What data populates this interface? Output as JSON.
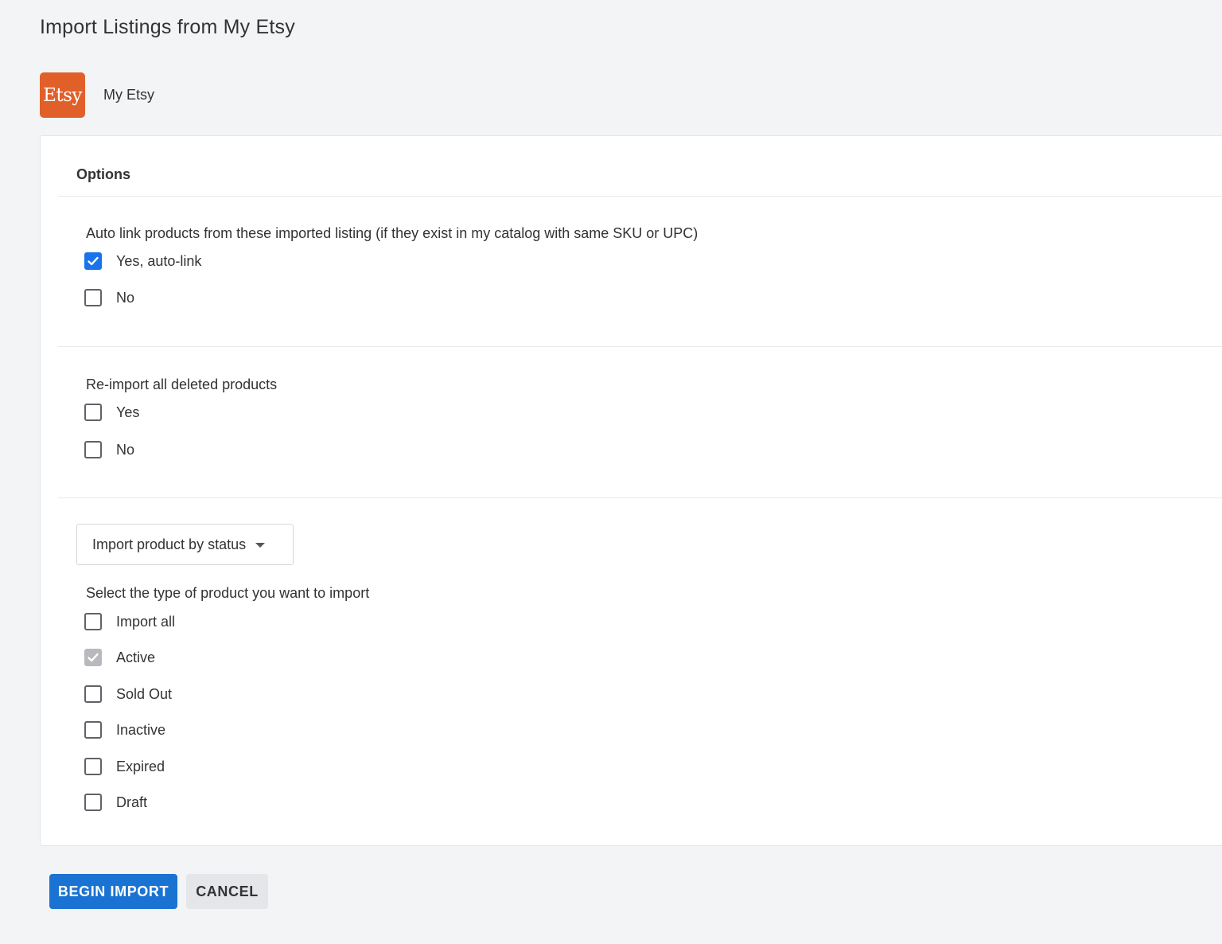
{
  "page": {
    "title": "Import Listings from My Etsy"
  },
  "store": {
    "logo_text": "Etsy",
    "name": "My Etsy",
    "brand_color": "#e1602a"
  },
  "options": {
    "header": "Options",
    "autolink": {
      "label": "Auto link products from these imported listing (if they exist in my catalog with same SKU or UPC)",
      "choices": [
        {
          "label": "Yes, auto-link",
          "checked": true
        },
        {
          "label": "No",
          "checked": false
        }
      ]
    },
    "reimport": {
      "label": "Re-import all deleted products",
      "choices": [
        {
          "label": "Yes",
          "checked": false
        },
        {
          "label": "No",
          "checked": false
        }
      ]
    },
    "status_select": {
      "selected": "Import product by status"
    },
    "product_types": {
      "label": "Select the type of product you want to import",
      "choices": [
        {
          "label": "Import all",
          "checked": false
        },
        {
          "label": "Active",
          "checked": true,
          "disabled": true
        },
        {
          "label": "Sold Out",
          "checked": false
        },
        {
          "label": "Inactive",
          "checked": false
        },
        {
          "label": "Expired",
          "checked": false
        },
        {
          "label": "Draft",
          "checked": false
        }
      ]
    }
  },
  "actions": {
    "begin_label": "BEGIN IMPORT",
    "cancel_label": "CANCEL"
  },
  "colors": {
    "accent": "#1a73e8",
    "primary_button": "#1a73d2",
    "background": "#f3f4f6"
  }
}
